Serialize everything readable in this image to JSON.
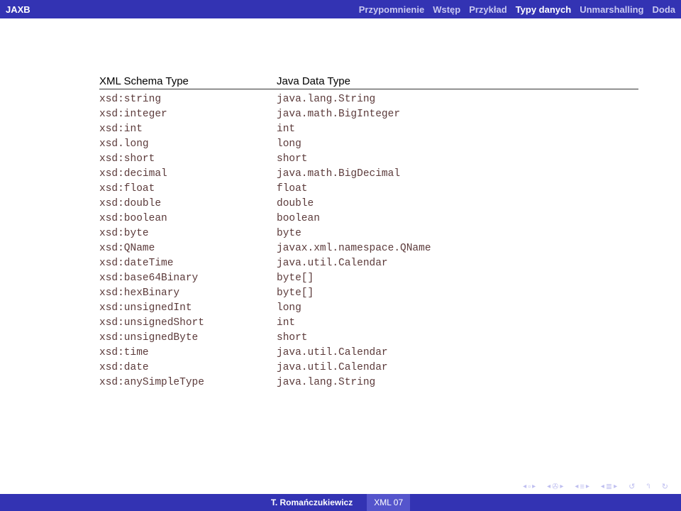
{
  "header": {
    "title": "JAXB",
    "nav": [
      {
        "label": "Przypomnienie",
        "active": false
      },
      {
        "label": "Wstęp",
        "active": false
      },
      {
        "label": "Przykład",
        "active": false
      },
      {
        "label": "Typy danych",
        "active": true
      },
      {
        "label": "Unmarshalling",
        "active": false
      },
      {
        "label": "Doda",
        "active": false
      }
    ]
  },
  "table": {
    "headers": {
      "col1": "XML Schema Type",
      "col2": "Java Data Type"
    },
    "rows": [
      {
        "xml": "xsd:string",
        "java": "java.lang.String"
      },
      {
        "xml": "xsd:integer",
        "java": "java.math.BigInteger"
      },
      {
        "xml": "xsd:int",
        "java": "int"
      },
      {
        "xml": "xsd.long",
        "java": "long"
      },
      {
        "xml": "xsd:short",
        "java": "short"
      },
      {
        "xml": "xsd:decimal",
        "java": "java.math.BigDecimal"
      },
      {
        "xml": "xsd:float",
        "java": "float"
      },
      {
        "xml": "xsd:double",
        "java": "double"
      },
      {
        "xml": "xsd:boolean",
        "java": "boolean"
      },
      {
        "xml": "xsd:byte",
        "java": "byte"
      },
      {
        "xml": "xsd:QName",
        "java": "javax.xml.namespace.QName"
      },
      {
        "xml": "xsd:dateTime",
        "java": "java.util.Calendar"
      },
      {
        "xml": "xsd:base64Binary",
        "java": "byte[]"
      },
      {
        "xml": "xsd:hexBinary",
        "java": "byte[]"
      },
      {
        "xml": "xsd:unsignedInt",
        "java": "long"
      },
      {
        "xml": "xsd:unsignedShort",
        "java": "int"
      },
      {
        "xml": "xsd:unsignedByte",
        "java": "short"
      },
      {
        "xml": "xsd:time",
        "java": "java.util.Calendar"
      },
      {
        "xml": "xsd:date",
        "java": "java.util.Calendar"
      },
      {
        "xml": "xsd:anySimpleType",
        "java": "java.lang.String"
      }
    ]
  },
  "footer": {
    "author": "T. Romańczukiewicz",
    "title": "XML 07"
  }
}
